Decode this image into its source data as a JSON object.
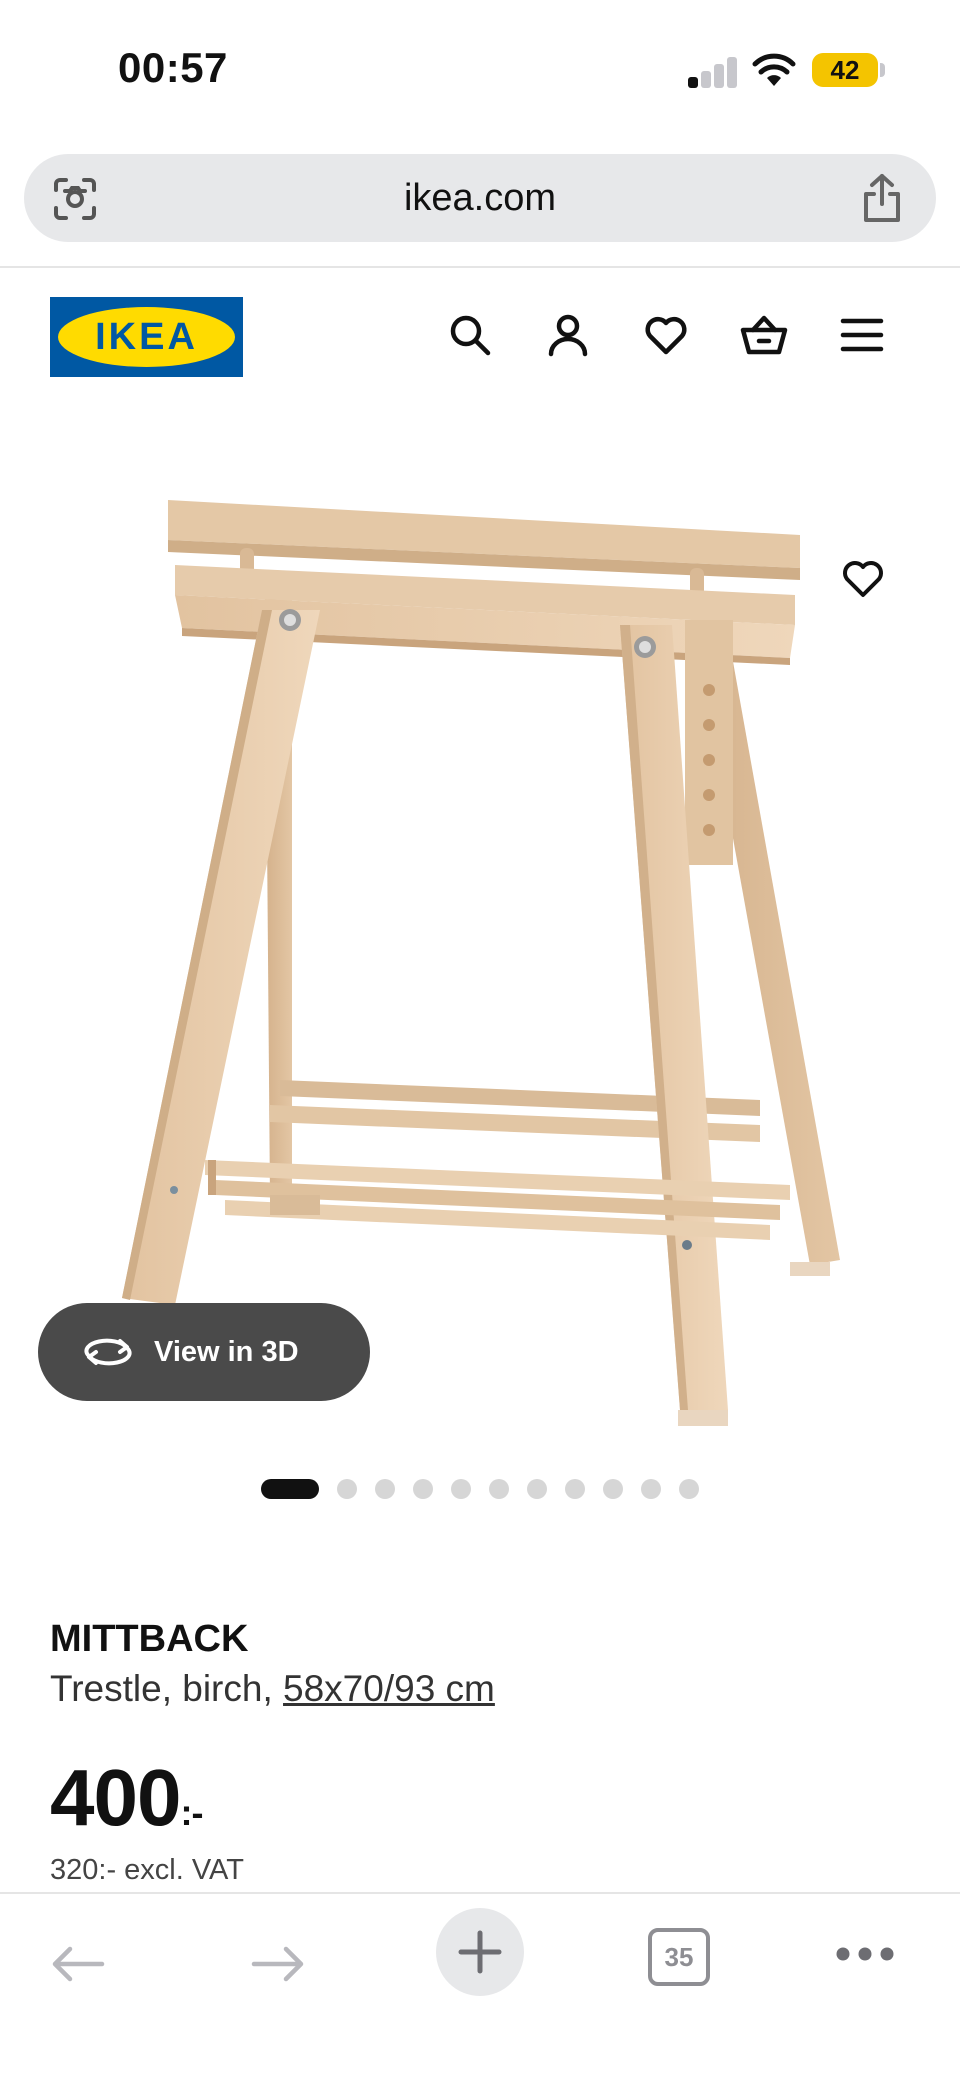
{
  "status_bar": {
    "time": "00:57",
    "battery": "42"
  },
  "browser": {
    "url": "ikea.com",
    "tab_count": "35"
  },
  "header": {
    "logo_text": "IKEA",
    "icons": [
      "search-icon",
      "account-icon",
      "heart-icon",
      "basket-icon",
      "menu-icon"
    ]
  },
  "gallery": {
    "view_3d_label": "View in 3D",
    "image_count": 11,
    "active_index": 0
  },
  "product": {
    "name": "MITTBACK",
    "description": "Trestle, birch, ",
    "size_link": "58x70/93 cm",
    "price": "400",
    "price_suffix": ":-",
    "price_excl_vat": "320:- excl. VAT"
  },
  "colors": {
    "ikea_blue": "#0058a3",
    "ikea_yellow": "#ffdb00",
    "battery_yellow": "#f4c400",
    "wood": "#e9cfb0"
  }
}
